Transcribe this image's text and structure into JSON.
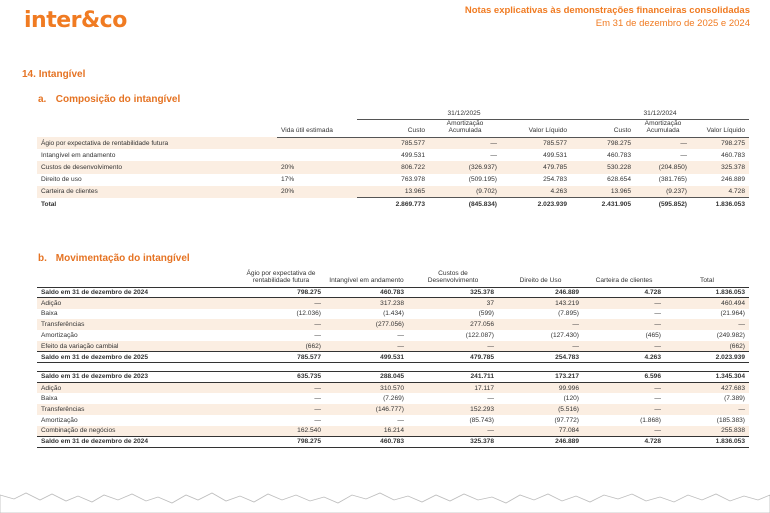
{
  "header": {
    "logo": "inter&co",
    "title": "Notas explicativas às demonstrações financeiras consolidadas",
    "subtitle": "Em 31 de dezembro de 2025 e 2024"
  },
  "section": {
    "number": "14.",
    "title": "Intangível"
  },
  "composition": {
    "letter": "a.",
    "title": "Composição do intangível",
    "group_2025": "31/12/2025",
    "group_2024": "31/12/2024",
    "columns": [
      "Vida útil estimada",
      "Custo",
      "Amortização Acumulada",
      "Valor Líquido",
      "Custo",
      "Amortização Acumulada",
      "Valor Líquido"
    ],
    "rows": [
      [
        "Ágio por expectativa de rentabilidade futura",
        "",
        "785.577",
        "—",
        "785.577",
        "798.275",
        "—",
        "798.275"
      ],
      [
        "Intangível em andamento",
        "",
        "499.531",
        "—",
        "499.531",
        "460.783",
        "—",
        "460.783"
      ],
      [
        "Custos de desenvolvimento",
        "20%",
        "806.722",
        "(326.937)",
        "479.785",
        "530.228",
        "(204.850)",
        "325.378"
      ],
      [
        "Direito de uso",
        "17%",
        "763.978",
        "(509.195)",
        "254.783",
        "628.654",
        "(381.765)",
        "246.889"
      ],
      [
        "Carteira de clientes",
        "20%",
        "13.965",
        "(9.702)",
        "4.263",
        "13.965",
        "(9.237)",
        "4.728"
      ]
    ],
    "total": [
      "Total",
      "",
      "2.869.773",
      "(845.834)",
      "2.023.939",
      "2.431.905",
      "(595.852)",
      "1.836.053"
    ]
  },
  "movement": {
    "letter": "b.",
    "title": "Movimentação do intangível",
    "columns": [
      "Ágio por expectativa de rentabilidade futura",
      "Intangível em andamento",
      "Custos de Desenvolvimento",
      "Direito de Uso",
      "Carteira de clientes",
      "Total"
    ],
    "block1": {
      "opening": [
        "Saldo em 31 de dezembro de 2024",
        "798.275",
        "460.783",
        "325.378",
        "246.889",
        "4.728",
        "1.836.053"
      ],
      "rows": [
        [
          "Adição",
          "—",
          "317.238",
          "37",
          "143.219",
          "—",
          "460.494"
        ],
        [
          "Baixa",
          "(12.036)",
          "(1.434)",
          "(599)",
          "(7.895)",
          "—",
          "(21.964)"
        ],
        [
          "Transferências",
          "—",
          "(277.056)",
          "277.056",
          "—",
          "—",
          "—"
        ],
        [
          "Amortização",
          "—",
          "—",
          "(122.087)",
          "(127.430)",
          "(465)",
          "(249.982)"
        ],
        [
          "Efeito da variação cambial",
          "(662)",
          "—",
          "—",
          "—",
          "—",
          "(662)"
        ]
      ],
      "closing": [
        "Saldo em 31 de dezembro de 2025",
        "785.577",
        "499.531",
        "479.785",
        "254.783",
        "4.263",
        "2.023.939"
      ]
    },
    "block2": {
      "opening": [
        "Saldo em 31 de dezembro de 2023",
        "635.735",
        "288.045",
        "241.711",
        "173.217",
        "6.596",
        "1.345.304"
      ],
      "rows": [
        [
          "Adição",
          "—",
          "310.570",
          "17.117",
          "99.996",
          "—",
          "427.683"
        ],
        [
          "Baixa",
          "—",
          "(7.269)",
          "—",
          "(120)",
          "—",
          "(7.389)"
        ],
        [
          "Transferências",
          "—",
          "(146.777)",
          "152.293",
          "(5.516)",
          "—",
          "—"
        ],
        [
          "Amortização",
          "—",
          "—",
          "(85.743)",
          "(97.772)",
          "(1.868)",
          "(185.383)"
        ],
        [
          "Combinação de negócios",
          "162.540",
          "16.214",
          "—",
          "77.084",
          "—",
          "255.838"
        ]
      ],
      "closing": [
        "Saldo em 31 de dezembro de 2024",
        "798.275",
        "460.783",
        "325.378",
        "246.889",
        "4.728",
        "1.836.053"
      ]
    }
  },
  "colors": {
    "accent": "#f07b22",
    "row_shade": "#fbeee2"
  }
}
